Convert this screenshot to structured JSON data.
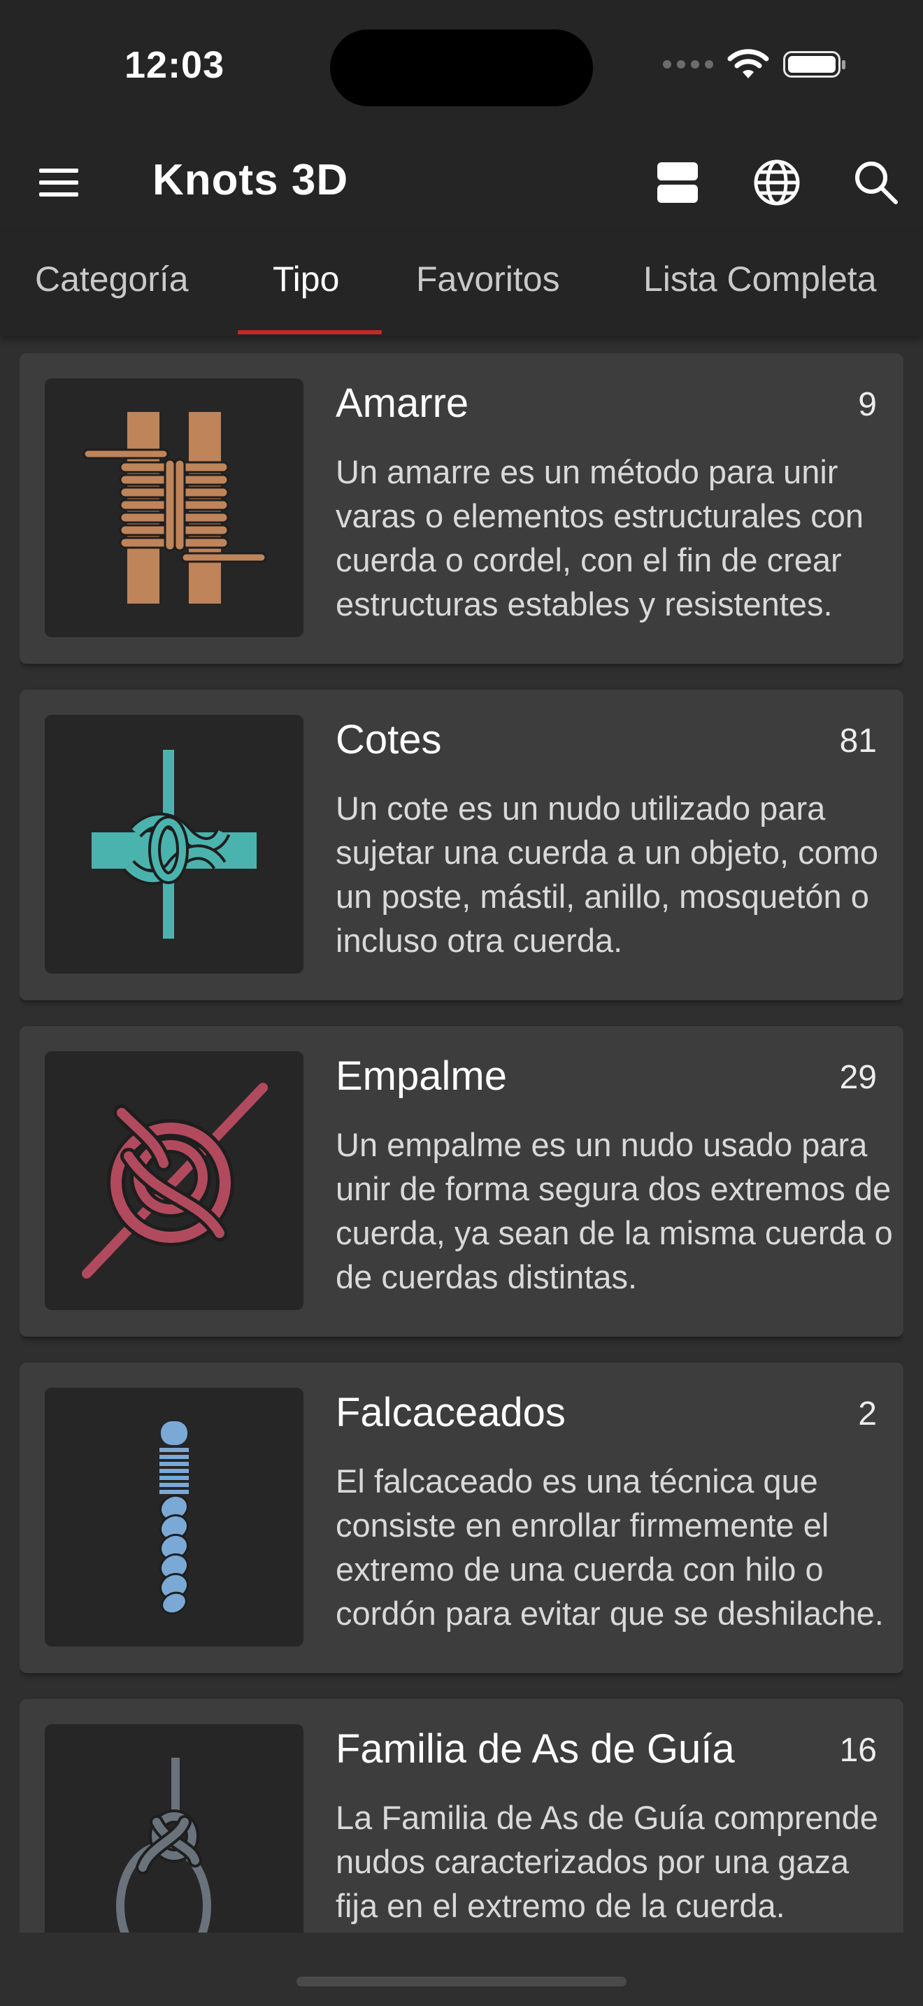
{
  "status_bar": {
    "time": "12:03"
  },
  "app_bar": {
    "title": "Knots 3D",
    "icons": [
      "menu-icon",
      "view-toggle-icon",
      "globe-icon",
      "search-icon"
    ]
  },
  "tabs": [
    {
      "label": "Categoría",
      "active": false
    },
    {
      "label": "Tipo",
      "active": true
    },
    {
      "label": "Favoritos",
      "active": false
    },
    {
      "label": "Lista Completa",
      "active": false
    }
  ],
  "colors": {
    "accent": "#c62828",
    "background": "#2f2f2f",
    "card": "#3d3d3d",
    "amarre": "#c0845a",
    "cotes": "#4bb3ad",
    "empalme": "#b24a5e",
    "falcaceados": "#7aa9d6",
    "as_de_guia": "#6a737c"
  },
  "types": [
    {
      "title": "Amarre",
      "count": "9",
      "description": "Un amarre es un método para unir varas o elementos estructurales con cuerda o cordel, con el fin de crear estructuras estables y resistentes.",
      "icon": "lashing-icon"
    },
    {
      "title": "Cotes",
      "count": "81",
      "description": "Un cote es un nudo utilizado para sujetar una cuerda a un objeto, como un poste, mástil, anillo, mosquetón o incluso otra cuerda.",
      "icon": "hitch-icon"
    },
    {
      "title": "Empalme",
      "count": "29",
      "description": "Un empalme es un nudo usado para unir de forma segura dos extremos de cuerda, ya sean de la misma cuerda o de cuerdas distintas.",
      "icon": "bend-icon"
    },
    {
      "title": "Falcaceados",
      "count": "2",
      "description": "El falcaceado es una técnica que consiste en enrollar firmemente el extremo de una cuerda con hilo o cordón para evitar que se deshilache.",
      "icon": "whipping-icon"
    },
    {
      "title": "Familia de As de Guía",
      "count": "16",
      "description": "La Familia de As de Guía comprende nudos caracterizados por una gaza fija en el extremo de la cuerda.",
      "icon": "bowline-icon"
    }
  ]
}
